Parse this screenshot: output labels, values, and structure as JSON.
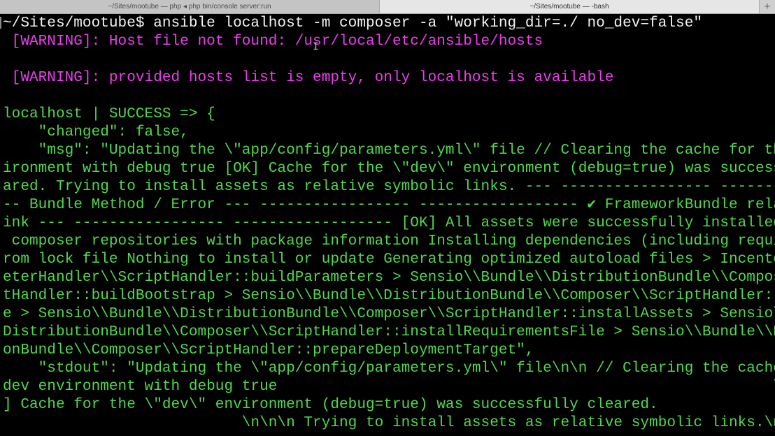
{
  "tabs": [
    {
      "title": "~/Sites/mootube — php ◂ php bin/console server:run",
      "active": false
    },
    {
      "title": "~/Sites/mootube — -bash",
      "active": true
    }
  ],
  "new_tab_label": "+",
  "icons": {
    "close": "close-icon",
    "new_tab": "plus-icon",
    "cursor": "ibeam-cursor-icon"
  },
  "colors": {
    "background": "#000000",
    "prompt": "#f2f2f2",
    "warning": "#ef3bef",
    "output": "#4fd94a"
  },
  "terminal": {
    "lines": [
      {
        "text": "~/Sites/mootube$ ansible localhost -m composer -a \"working_dir=./ no_dev=false\"",
        "color": "white"
      },
      {
        "text": " [WARNING]: Host file not found: /usr/local/etc/ansible/hosts",
        "color": "magenta"
      },
      {
        "text": "",
        "color": "green"
      },
      {
        "text": " [WARNING]: provided hosts list is empty, only localhost is available",
        "color": "magenta"
      },
      {
        "text": "",
        "color": "green"
      },
      {
        "text": "localhost | SUCCESS => {",
        "color": "green"
      },
      {
        "text": "    \"changed\": false,",
        "color": "green"
      },
      {
        "text": "    \"msg\": \"Updating the \\\"app/config/parameters.yml\\\" file // Clearing the cache for the dev env",
        "color": "green"
      },
      {
        "text": "ironment with debug true [OK] Cache for the \\\"dev\\\" environment (debug=true) was successfully cle",
        "color": "green"
      },
      {
        "text": "ared. Trying to install assets as relative symbolic links. --- ----------------- ----------------",
        "color": "green"
      },
      {
        "text": "-- Bundle Method / Error --- ----------------- ------------------ ✔ FrameworkBundle relative syml",
        "color": "green"
      },
      {
        "text": "ink --- ----------------- ------------------ [OK] All assets were successfully installed. Loading",
        "color": "green"
      },
      {
        "text": " composer repositories with package information Installing dependencies (including require-dev) f",
        "color": "green"
      },
      {
        "text": "rom lock file Nothing to install or update Generating optimized autoload files > Incenteev\\\\Param",
        "color": "green"
      },
      {
        "text": "eterHandler\\\\ScriptHandler::buildParameters > Sensio\\\\Bundle\\\\DistributionBundle\\\\Composer\\\\Scrip",
        "color": "green"
      },
      {
        "text": "tHandler::buildBootstrap > Sensio\\\\Bundle\\\\DistributionBundle\\\\Composer\\\\ScriptHandler::clearCach",
        "color": "green"
      },
      {
        "text": "e > Sensio\\\\Bundle\\\\DistributionBundle\\\\Composer\\\\ScriptHandler::installAssets > Sensio\\\\Bundle\\\\",
        "color": "green"
      },
      {
        "text": "DistributionBundle\\\\Composer\\\\ScriptHandler::installRequirementsFile > Sensio\\\\Bundle\\\\Distributi",
        "color": "green"
      },
      {
        "text": "onBundle\\\\Composer\\\\ScriptHandler::prepareDeploymentTarget\",",
        "color": "green"
      },
      {
        "text": "    \"stdout\": \"Updating the \\\"app/config/parameters.yml\\\" file\\n\\n // Clearing the cache for the",
        "color": "green"
      },
      {
        "text": "dev environment with debug true                                                        \\n\\n [OK",
        "color": "green"
      },
      {
        "text": "] Cache for the \\\"dev\\\" environment (debug=true) was successfully cleared.",
        "color": "green"
      },
      {
        "text": "                           \\n\\n\\n Trying to install assets as relative symbolic links.\\n\\n --- --------",
        "color": "green"
      }
    ]
  }
}
